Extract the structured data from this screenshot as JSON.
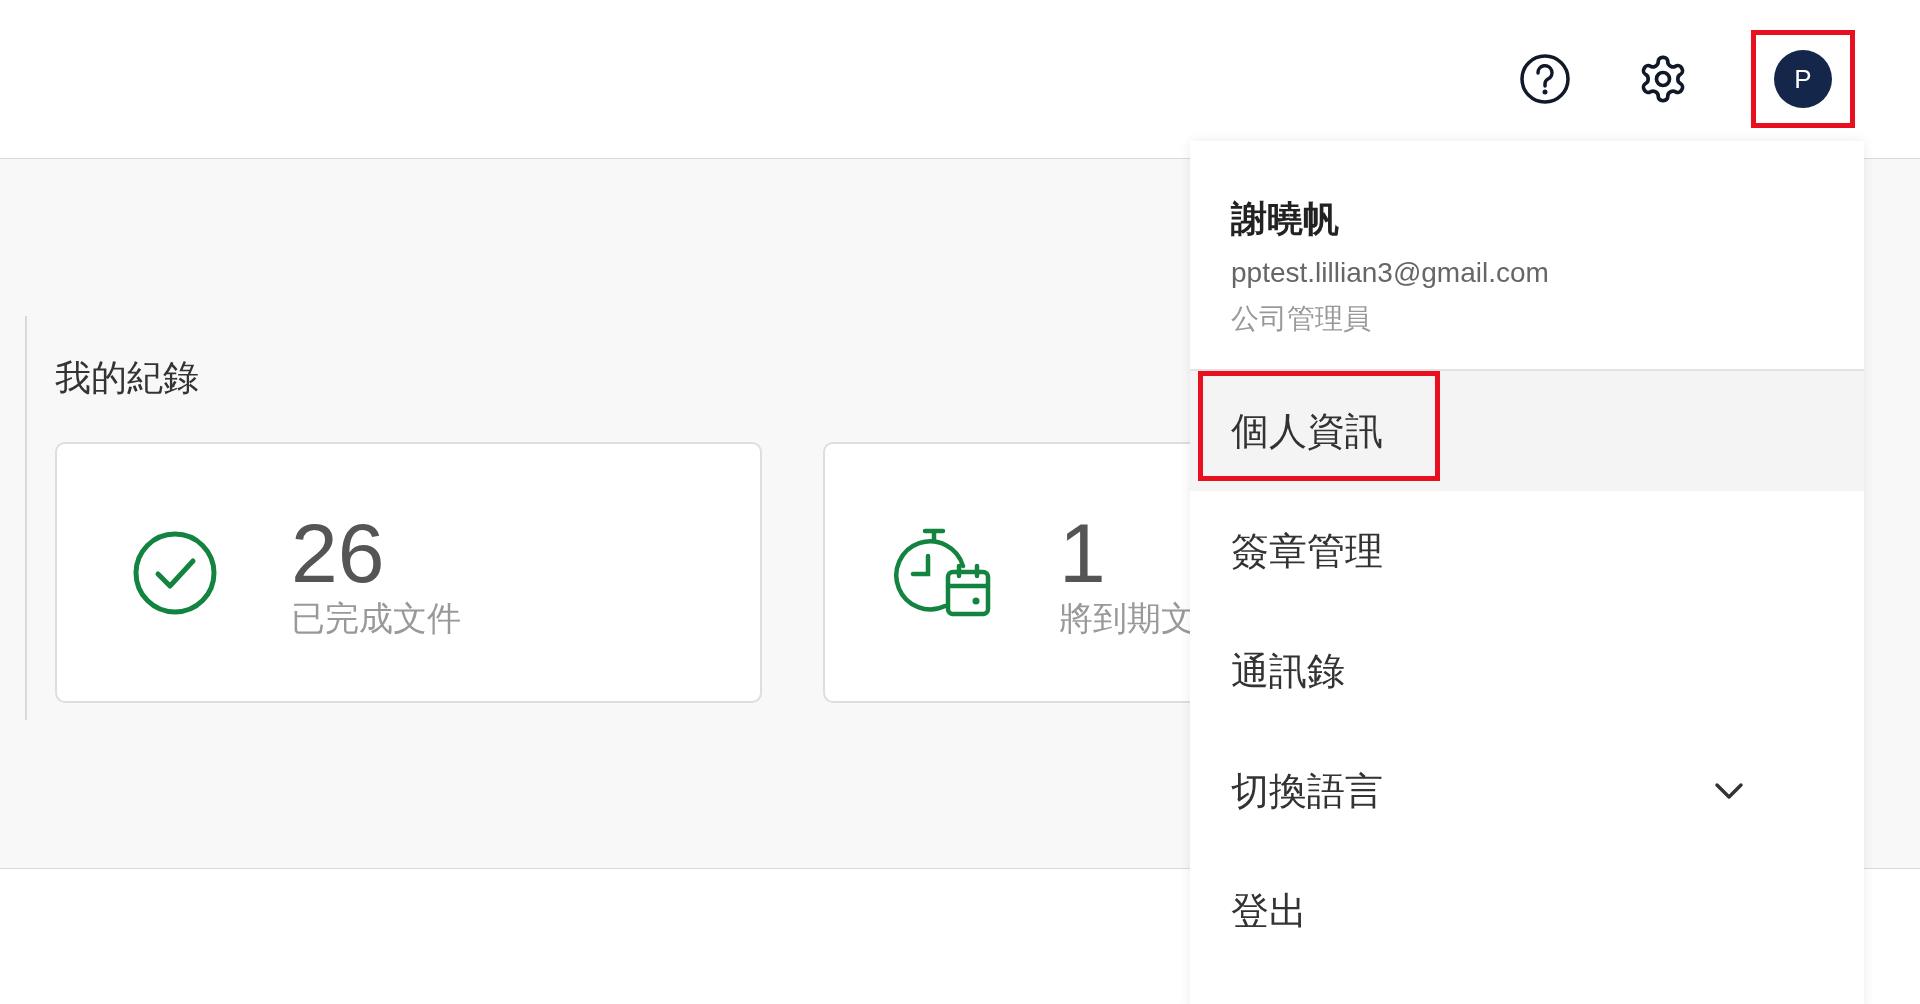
{
  "header": {
    "avatar_letter": "P"
  },
  "records": {
    "title": "我的紀錄",
    "cards": [
      {
        "kind": "done",
        "count": "26",
        "label": "已完成文件"
      },
      {
        "kind": "due",
        "count": "1",
        "label": "將到期文"
      }
    ]
  },
  "user_menu": {
    "name": "謝曉帆",
    "email": "pptest.lillian3@gmail.com",
    "role": "公司管理員",
    "items": [
      {
        "label": "個人資訊",
        "selected": true,
        "kind": "link"
      },
      {
        "label": "簽章管理",
        "selected": false,
        "kind": "link"
      },
      {
        "label": "通訊錄",
        "selected": false,
        "kind": "link"
      },
      {
        "label": "切換語言",
        "selected": false,
        "kind": "expand"
      },
      {
        "label": "登出",
        "selected": false,
        "kind": "link"
      }
    ]
  }
}
